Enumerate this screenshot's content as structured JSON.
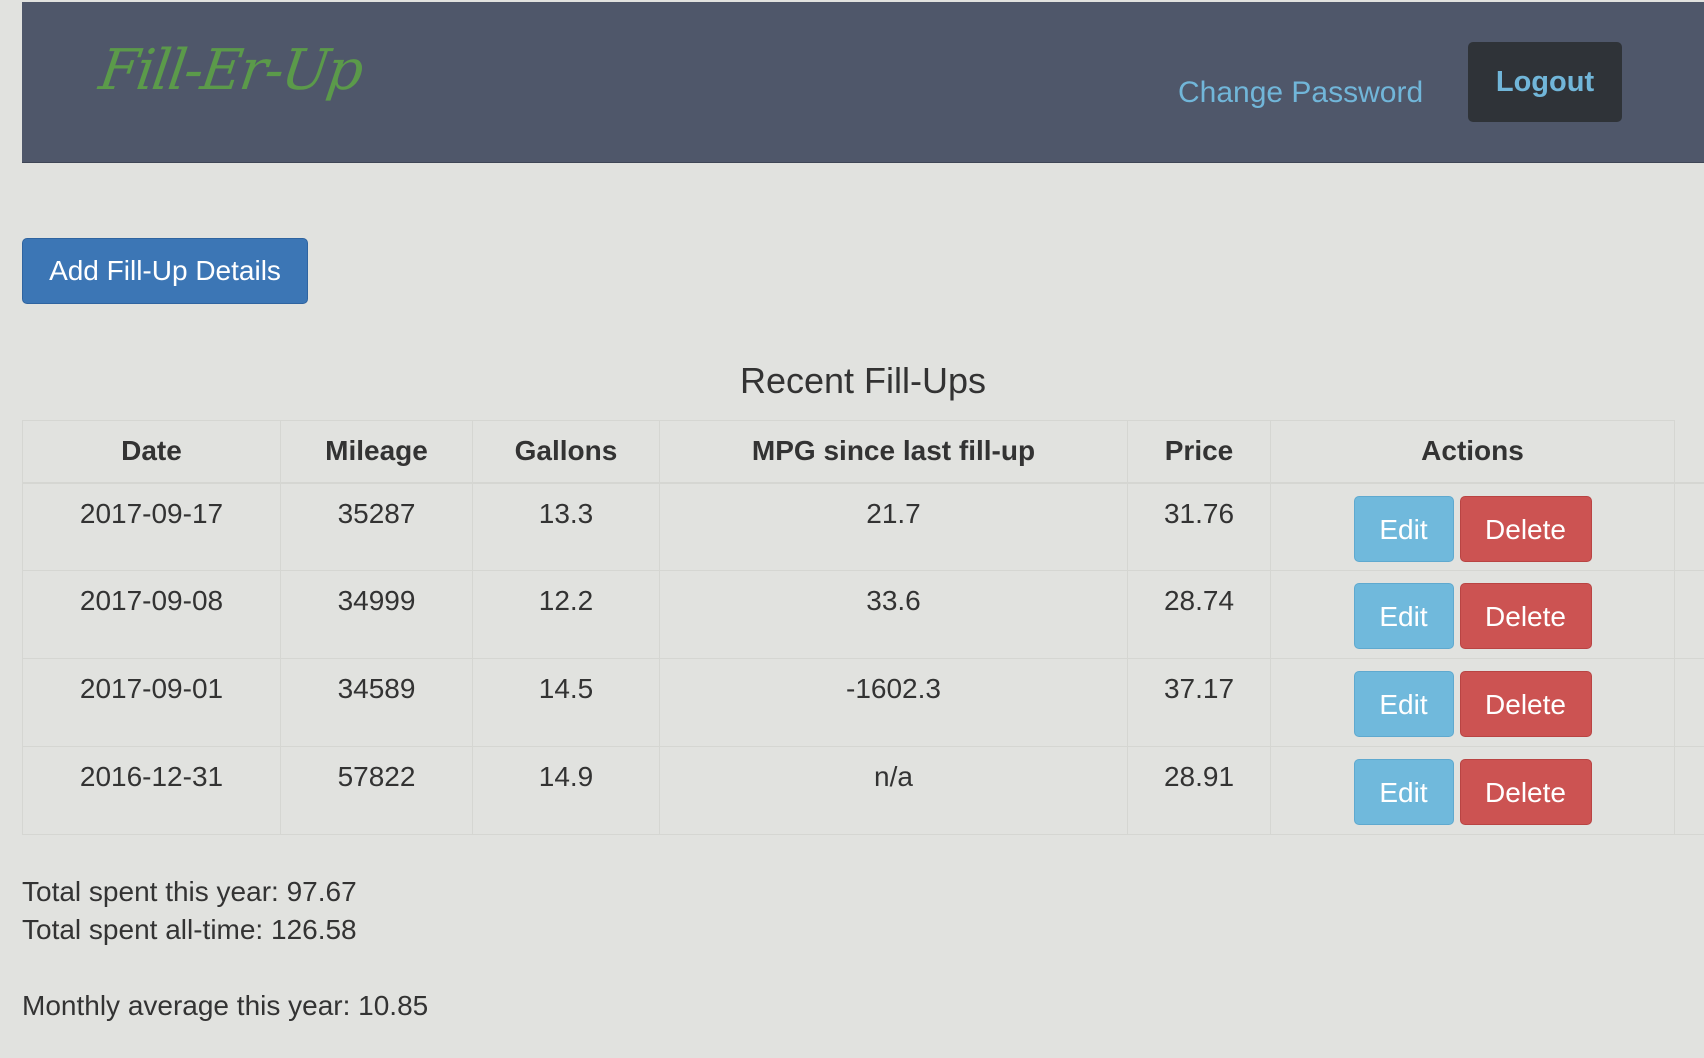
{
  "navbar": {
    "brand": "Fill-Er-Up",
    "change_password": "Change Password",
    "logout": "Logout"
  },
  "actions": {
    "add_button": "Add Fill-Up Details"
  },
  "table": {
    "title": "Recent Fill-Ups",
    "headers": [
      "Date",
      "Mileage",
      "Gallons",
      "MPG since last fill-up",
      "Price",
      "Actions"
    ],
    "rows": [
      {
        "date": "2017-09-17",
        "mileage": "35287",
        "gallons": "13.3",
        "mpg": "21.7",
        "price": "31.76",
        "edit": "Edit",
        "delete": "Delete"
      },
      {
        "date": "2017-09-08",
        "mileage": "34999",
        "gallons": "12.2",
        "mpg": "33.6",
        "price": "28.74",
        "edit": "Edit",
        "delete": "Delete"
      },
      {
        "date": "2017-09-01",
        "mileage": "34589",
        "gallons": "14.5",
        "mpg": "-1602.3",
        "price": "37.17",
        "edit": "Edit",
        "delete": "Delete"
      },
      {
        "date": "2016-12-31",
        "mileage": "57822",
        "gallons": "14.9",
        "mpg": "n/a",
        "price": "28.91",
        "edit": "Edit",
        "delete": "Delete"
      }
    ]
  },
  "summary": {
    "total_year": "Total spent this year: 97.67",
    "total_all_time": "Total spent all-time: 126.58",
    "monthly_average": "Monthly average this year: 10.85"
  },
  "colors": {
    "navbar_bg": "#4f576a",
    "brand": "#5b9a4a",
    "link": "#71b6d9",
    "primary": "#3c76b5",
    "info": "#70b9dc",
    "danger": "#cc5352",
    "page_bg": "#e1e2df"
  }
}
